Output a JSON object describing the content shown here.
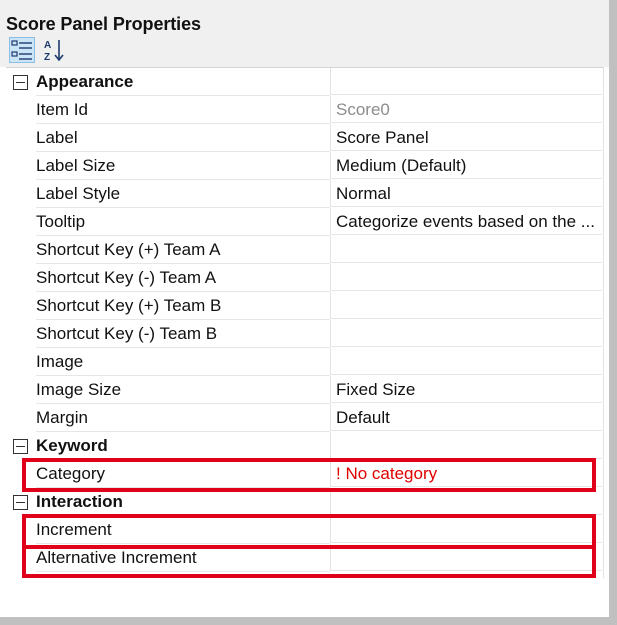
{
  "window": {
    "title": "Score Panel Properties"
  },
  "toolbar": {
    "categorized_icon": "categorized-view-icon",
    "alphabetical_icon": "sort-az-icon"
  },
  "categories": [
    {
      "label": "Appearance",
      "rows": [
        {
          "name": "Item Id",
          "value": "Score0",
          "style": "muted"
        },
        {
          "name": "Label",
          "value": "Score Panel"
        },
        {
          "name": "Label Size",
          "value": "Medium (Default)"
        },
        {
          "name": "Label Style",
          "value": "Normal"
        },
        {
          "name": "Tooltip",
          "value": "Categorize events based on the ..."
        },
        {
          "name": "Shortcut Key (+) Team A",
          "value": ""
        },
        {
          "name": "Shortcut Key (-) Team A",
          "value": ""
        },
        {
          "name": "Shortcut Key (+) Team B",
          "value": ""
        },
        {
          "name": "Shortcut Key (-) Team B",
          "value": ""
        },
        {
          "name": "Image",
          "value": ""
        },
        {
          "name": "Image Size",
          "value": "Fixed Size"
        },
        {
          "name": "Margin",
          "value": "Default"
        }
      ]
    },
    {
      "label": "Keyword",
      "rows": [
        {
          "name": "Category",
          "value": "! No category",
          "style": "error"
        }
      ]
    },
    {
      "label": "Interaction",
      "rows": [
        {
          "name": "Increment",
          "value": ""
        },
        {
          "name": "Alternative Increment",
          "value": ""
        }
      ]
    }
  ],
  "colors": {
    "highlight": "#e0001a",
    "error_text": "#e00000",
    "muted_text": "#8c8c8c",
    "selected_button": "#cce4f7"
  }
}
